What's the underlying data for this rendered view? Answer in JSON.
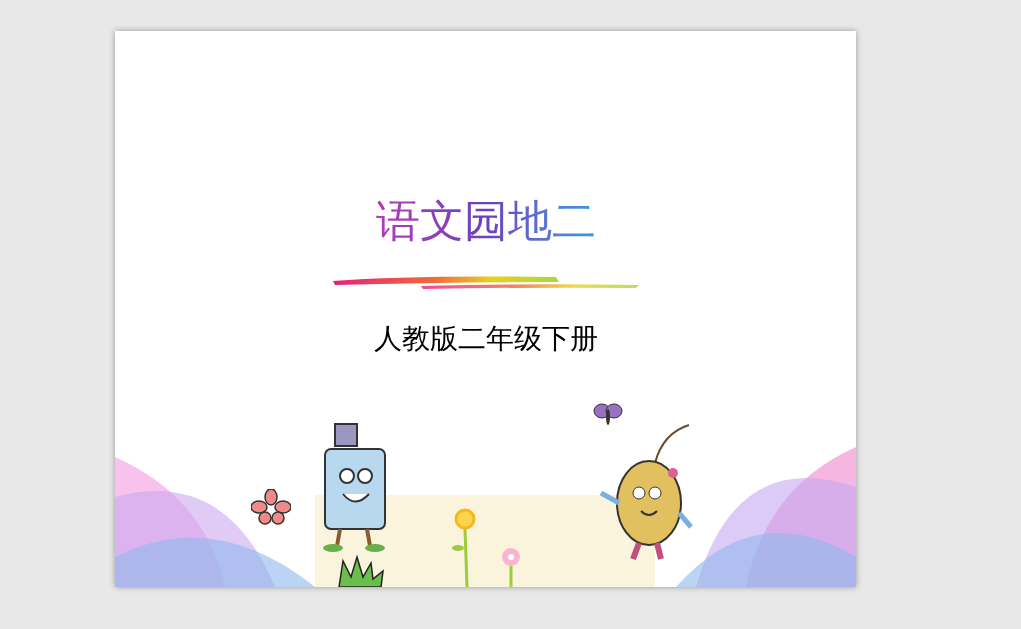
{
  "slide": {
    "title": "语文园地二",
    "subtitle": "人教版二年级下册"
  }
}
